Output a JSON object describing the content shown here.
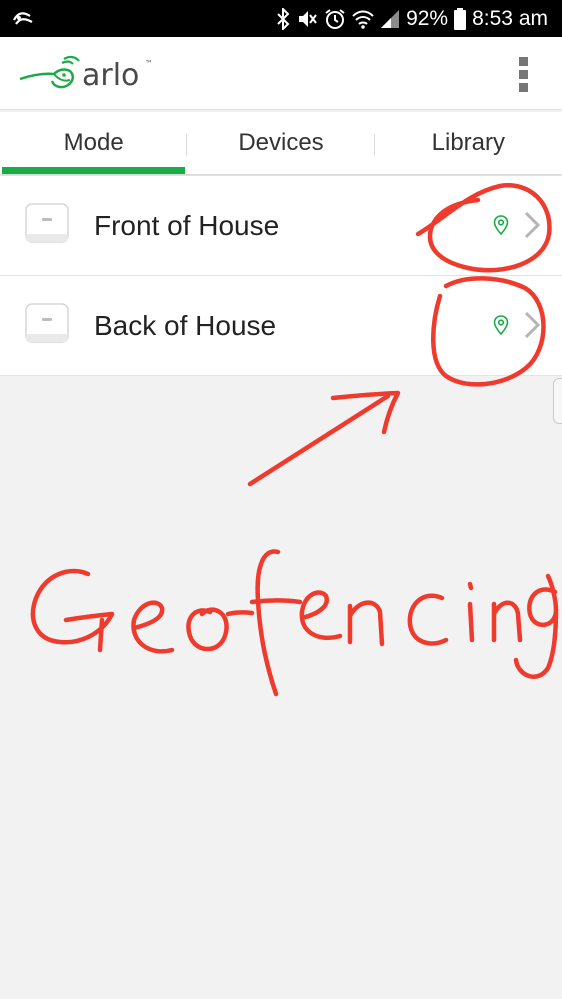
{
  "status_bar": {
    "battery": "92%",
    "time": "8:53 am"
  },
  "app": {
    "logo_text": "arlo",
    "logo_mark": "™"
  },
  "tabs": [
    {
      "label": "Mode",
      "active": true
    },
    {
      "label": "Devices",
      "active": false
    },
    {
      "label": "Library",
      "active": false
    }
  ],
  "devices": [
    {
      "name": "Front of House",
      "geofencing": true
    },
    {
      "name": "Back of House",
      "geofencing": true
    }
  ],
  "annotation": {
    "text": "Geofencing",
    "color": "#ef3b2d"
  },
  "colors": {
    "accent": "#1aab47"
  }
}
